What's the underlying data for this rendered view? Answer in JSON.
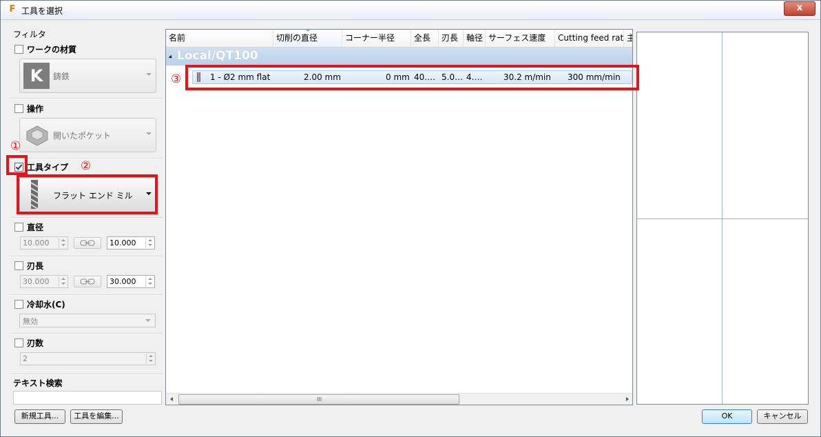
{
  "window": {
    "title": "工具を選択",
    "app_icon": "F",
    "close_glyph": "x"
  },
  "filter": {
    "label": "フィルタ",
    "workpiece_material": {
      "label": "ワークの材質",
      "checked": false,
      "icon_letter": "K",
      "value": "鋳鉄"
    },
    "operation": {
      "label": "操作",
      "checked": false,
      "value": "開いたポケット"
    },
    "tool_type": {
      "label": "工具タイプ",
      "checked": true,
      "value": "フラット エンド ミル"
    },
    "diameter": {
      "label": "直径",
      "checked": false,
      "min": "10.000",
      "max": "10.000"
    },
    "flute_length": {
      "label": "刃長",
      "checked": false,
      "min": "30.000",
      "max": "30.000"
    },
    "coolant": {
      "label": "冷却水(C)",
      "checked": false,
      "value": "無効"
    },
    "flutes": {
      "label": "刃数",
      "checked": false,
      "value": "2"
    },
    "text_search": {
      "label": "テキスト検索",
      "value": ""
    }
  },
  "buttons": {
    "new_tool": "新規工具...",
    "edit_tool": "工具を編集...",
    "ok": "OK",
    "cancel": "キャンセル"
  },
  "table": {
    "columns": [
      "名前",
      "切削の直径",
      "コーナー半径",
      "全長",
      "刃長",
      "軸径",
      "サーフェス速度",
      "Cutting feed rat",
      "主"
    ],
    "sorted_column": "切削の直径",
    "group": "Local/QT100",
    "rows": [
      {
        "name": "1 - Ø2 mm flat",
        "cutting_diameter": "2.00 mm",
        "corner_radius": "0 mm",
        "overall_length": "40.…",
        "flute_length": "5.0…",
        "shaft_diameter": "4.…",
        "surface_speed": "30.2 m/min",
        "cutting_feed_rate": "300 mm/min"
      }
    ],
    "scroll_grip": "III"
  },
  "annotations": {
    "a1": "①",
    "a2": "②",
    "a3": "③"
  },
  "colors": {
    "annotation_red": "#e0161e",
    "group_header": "#c3d8ed",
    "selection": "#d7e8f6"
  }
}
